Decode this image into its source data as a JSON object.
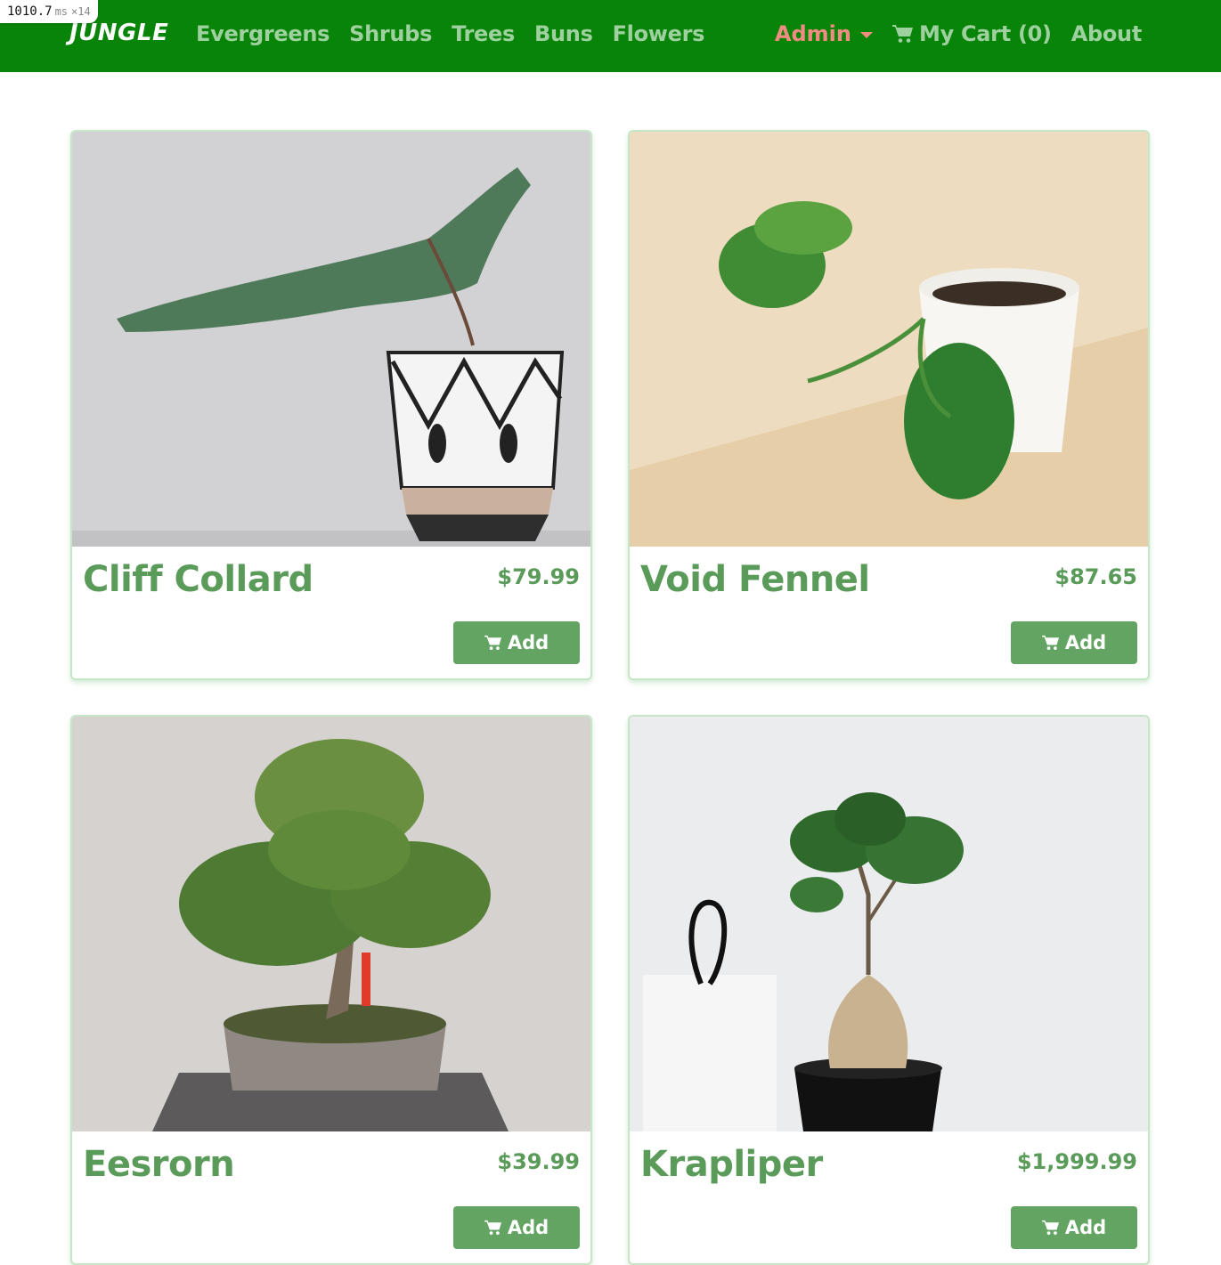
{
  "perf": {
    "value": "1010.7",
    "unit": "ms",
    "multiplier": "×14"
  },
  "nav": {
    "brand": "JUNGLE",
    "links": [
      "Evergreens",
      "Shrubs",
      "Trees",
      "Buns",
      "Flowers"
    ],
    "admin": "Admin",
    "cart": "My Cart (0)",
    "about": "About"
  },
  "products": [
    {
      "name": "Cliff Collard",
      "price": "$79.99",
      "button": "Add"
    },
    {
      "name": "Void Fennel",
      "price": "$87.65",
      "button": "Add"
    },
    {
      "name": "Eesrorn",
      "price": "$39.99",
      "button": "Add"
    },
    {
      "name": "Krapliper",
      "price": "$1,999.99",
      "button": "Add"
    }
  ],
  "colors": {
    "navbar": "#088508",
    "accent": "#5a9b5a",
    "admin": "#f28b82"
  }
}
